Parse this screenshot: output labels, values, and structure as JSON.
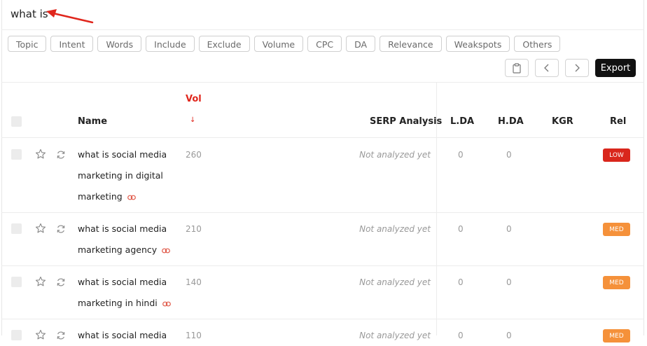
{
  "search": {
    "query": "what is"
  },
  "filters": [
    "Topic",
    "Intent",
    "Words",
    "Include",
    "Exclude",
    "Volume",
    "CPC",
    "DA",
    "Relevance",
    "Weakspots",
    "Others"
  ],
  "toolbar": {
    "export_label": "Export",
    "icons": [
      "clipboard-icon",
      "chevron-left-icon",
      "chevron-right-icon"
    ]
  },
  "table": {
    "columns": {
      "vol": "Vol",
      "vol_sort": "↓",
      "name": "Name",
      "serp": "SERP Analysis",
      "lda": "L.DA",
      "hda": "H.DA",
      "kgr": "KGR",
      "rel": "Rel"
    },
    "rows": [
      {
        "lines": [
          "what is social media",
          "marketing in digital",
          "marketing"
        ],
        "vol": "260",
        "serp": "Not analyzed yet",
        "lda": "0",
        "hda": "0",
        "kgr": "",
        "rel": "LOW",
        "rel_color": "#d9261c"
      },
      {
        "lines": [
          "what is social media",
          "marketing agency"
        ],
        "vol": "210",
        "serp": "Not analyzed yet",
        "lda": "0",
        "hda": "0",
        "kgr": "",
        "rel": "MED",
        "rel_color": "#f5913a"
      },
      {
        "lines": [
          "what is social media",
          "marketing in hindi"
        ],
        "vol": "140",
        "serp": "Not analyzed yet",
        "lda": "0",
        "hda": "0",
        "kgr": "",
        "rel": "MED",
        "rel_color": "#f5913a"
      },
      {
        "lines": [
          "what is social media"
        ],
        "vol": "110",
        "serp": "Not analyzed yet",
        "lda": "0",
        "hda": "0",
        "kgr": "",
        "rel": "MED",
        "rel_color": "#f5913a"
      }
    ]
  },
  "colors": {
    "accent": "#e0261c",
    "link_icon": "#e05a4a"
  }
}
